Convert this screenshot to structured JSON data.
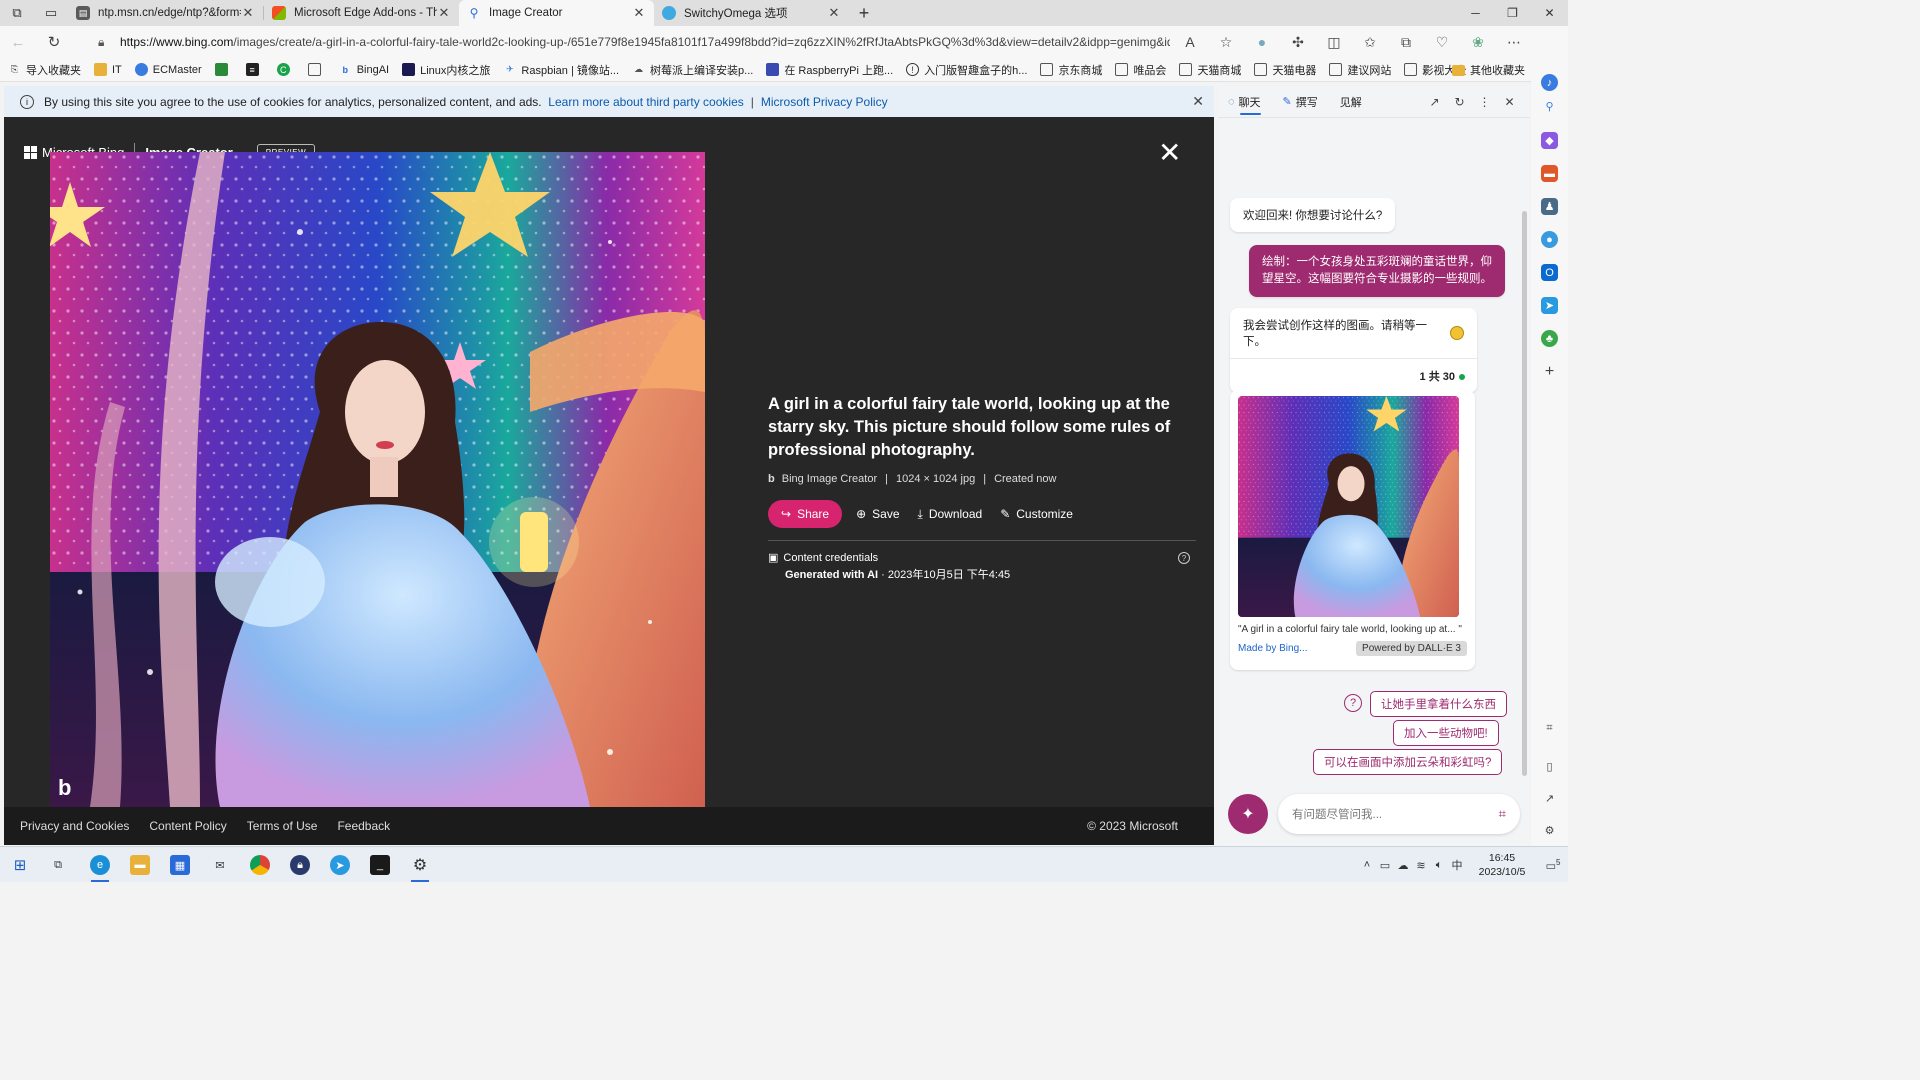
{
  "tabs": [
    {
      "label": "ntp.msn.cn/edge/ntp?&form=M",
      "active": false
    },
    {
      "label": "Microsoft Edge Add-ons - Theme",
      "active": false
    },
    {
      "label": "Image Creator",
      "active": true
    },
    {
      "label": "SwitchyOmega 选项",
      "active": false
    }
  ],
  "address": {
    "url_host": "https://www.bing.com",
    "url_path": "/images/create/a-girl-in-a-colorful-fairy-tale-world2c-looking-up-/651e779f8e1945fa8101f17a499f8bdd?id=zq6zzXIN%2fRfJtaAbtsPkGQ%3d%3d&view=detailv2&idpp=genimg&idpc..."
  },
  "favorites": [
    "导入收藏夹",
    "IT",
    "ECMaster",
    "",
    "",
    "",
    "",
    "BingAI",
    "Linux内核之旅",
    "Raspbian | 镜像站...",
    "树莓派上编译安装p...",
    "在 RaspberryPi 上跑...",
    "入门版智趣盒子的h...",
    "京东商城",
    "唯品会",
    "天猫商城",
    "天猫电器",
    "建议网站",
    "影视大全"
  ],
  "favorites_other": "其他收藏夹",
  "cookie": {
    "text": "By using this site you agree to the use of cookies for analytics, personalized content, and ads.",
    "link1": "Learn more about third party cookies",
    "sep": "|",
    "link2": "Microsoft Privacy Policy"
  },
  "brand": {
    "company": "Microsoft Bing",
    "product": "Image Creator",
    "badge": "PREVIEW"
  },
  "detail": {
    "title": "A girl in a colorful fairy tale world, looking up at the starry sky. This picture should follow some rules of professional photography.",
    "source": "Bing Image Creator",
    "size": "1024 × 1024 jpg",
    "created": "Created now",
    "sep": "|",
    "actions": {
      "share": "Share",
      "save": "Save",
      "download": "Download",
      "customize": "Customize"
    },
    "credentials_label": "Content credentials",
    "generated": "Generated with AI",
    "timestamp": " · 2023年10月5日 下午4:45"
  },
  "footer": {
    "links": [
      "Privacy and Cookies",
      "Content Policy",
      "Terms of Use",
      "Feedback"
    ],
    "copyright": "© 2023 Microsoft"
  },
  "sidebar": {
    "tabs": [
      "聊天",
      "撰写",
      "见解"
    ],
    "messages": {
      "welcome": "欢迎回来! 你想要讨论什么?",
      "user_prompt": "绘制：一个女孩身处五彩斑斓的童话世界，仰望星空。这幅图要符合专业摄影的一些规则。",
      "reply": "我会尝试创作这样的图画。请稍等一下。",
      "count": "1 共 30",
      "caption": "\"A girl in a colorful fairy tale world, looking up at... \"",
      "made_by": "Made by Bing...",
      "powered": "Powered by DALL·E 3"
    },
    "suggestions": [
      "让她手里拿着什么东西",
      "加入一些动物吧!",
      "可以在画面中添加云朵和彩虹吗?"
    ],
    "input_placeholder": "有问题尽管问我..."
  },
  "taskbar": {
    "time": "16:45",
    "date": "2023/10/5",
    "ime": "中",
    "notifications": "5"
  },
  "colors": {
    "accent_pink": "#d6246e",
    "chat_purple": "#9e2b6f",
    "viewer_bg": "#272727"
  }
}
